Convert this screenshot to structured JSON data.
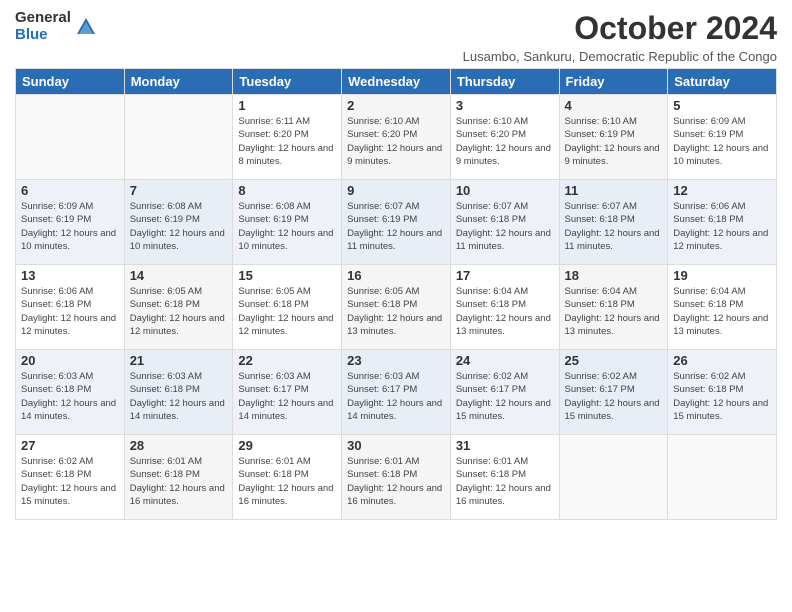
{
  "logo": {
    "general": "General",
    "blue": "Blue"
  },
  "title": "October 2024",
  "subtitle": "Lusambo, Sankuru, Democratic Republic of the Congo",
  "days_of_week": [
    "Sunday",
    "Monday",
    "Tuesday",
    "Wednesday",
    "Thursday",
    "Friday",
    "Saturday"
  ],
  "weeks": [
    [
      {
        "day": "",
        "info": ""
      },
      {
        "day": "",
        "info": ""
      },
      {
        "day": "1",
        "info": "Sunrise: 6:11 AM\nSunset: 6:20 PM\nDaylight: 12 hours and 8 minutes."
      },
      {
        "day": "2",
        "info": "Sunrise: 6:10 AM\nSunset: 6:20 PM\nDaylight: 12 hours and 9 minutes."
      },
      {
        "day": "3",
        "info": "Sunrise: 6:10 AM\nSunset: 6:20 PM\nDaylight: 12 hours and 9 minutes."
      },
      {
        "day": "4",
        "info": "Sunrise: 6:10 AM\nSunset: 6:19 PM\nDaylight: 12 hours and 9 minutes."
      },
      {
        "day": "5",
        "info": "Sunrise: 6:09 AM\nSunset: 6:19 PM\nDaylight: 12 hours and 10 minutes."
      }
    ],
    [
      {
        "day": "6",
        "info": "Sunrise: 6:09 AM\nSunset: 6:19 PM\nDaylight: 12 hours and 10 minutes."
      },
      {
        "day": "7",
        "info": "Sunrise: 6:08 AM\nSunset: 6:19 PM\nDaylight: 12 hours and 10 minutes."
      },
      {
        "day": "8",
        "info": "Sunrise: 6:08 AM\nSunset: 6:19 PM\nDaylight: 12 hours and 10 minutes."
      },
      {
        "day": "9",
        "info": "Sunrise: 6:07 AM\nSunset: 6:19 PM\nDaylight: 12 hours and 11 minutes."
      },
      {
        "day": "10",
        "info": "Sunrise: 6:07 AM\nSunset: 6:18 PM\nDaylight: 12 hours and 11 minutes."
      },
      {
        "day": "11",
        "info": "Sunrise: 6:07 AM\nSunset: 6:18 PM\nDaylight: 12 hours and 11 minutes."
      },
      {
        "day": "12",
        "info": "Sunrise: 6:06 AM\nSunset: 6:18 PM\nDaylight: 12 hours and 12 minutes."
      }
    ],
    [
      {
        "day": "13",
        "info": "Sunrise: 6:06 AM\nSunset: 6:18 PM\nDaylight: 12 hours and 12 minutes."
      },
      {
        "day": "14",
        "info": "Sunrise: 6:05 AM\nSunset: 6:18 PM\nDaylight: 12 hours and 12 minutes."
      },
      {
        "day": "15",
        "info": "Sunrise: 6:05 AM\nSunset: 6:18 PM\nDaylight: 12 hours and 12 minutes."
      },
      {
        "day": "16",
        "info": "Sunrise: 6:05 AM\nSunset: 6:18 PM\nDaylight: 12 hours and 13 minutes."
      },
      {
        "day": "17",
        "info": "Sunrise: 6:04 AM\nSunset: 6:18 PM\nDaylight: 12 hours and 13 minutes."
      },
      {
        "day": "18",
        "info": "Sunrise: 6:04 AM\nSunset: 6:18 PM\nDaylight: 12 hours and 13 minutes."
      },
      {
        "day": "19",
        "info": "Sunrise: 6:04 AM\nSunset: 6:18 PM\nDaylight: 12 hours and 13 minutes."
      }
    ],
    [
      {
        "day": "20",
        "info": "Sunrise: 6:03 AM\nSunset: 6:18 PM\nDaylight: 12 hours and 14 minutes."
      },
      {
        "day": "21",
        "info": "Sunrise: 6:03 AM\nSunset: 6:18 PM\nDaylight: 12 hours and 14 minutes."
      },
      {
        "day": "22",
        "info": "Sunrise: 6:03 AM\nSunset: 6:17 PM\nDaylight: 12 hours and 14 minutes."
      },
      {
        "day": "23",
        "info": "Sunrise: 6:03 AM\nSunset: 6:17 PM\nDaylight: 12 hours and 14 minutes."
      },
      {
        "day": "24",
        "info": "Sunrise: 6:02 AM\nSunset: 6:17 PM\nDaylight: 12 hours and 15 minutes."
      },
      {
        "day": "25",
        "info": "Sunrise: 6:02 AM\nSunset: 6:17 PM\nDaylight: 12 hours and 15 minutes."
      },
      {
        "day": "26",
        "info": "Sunrise: 6:02 AM\nSunset: 6:18 PM\nDaylight: 12 hours and 15 minutes."
      }
    ],
    [
      {
        "day": "27",
        "info": "Sunrise: 6:02 AM\nSunset: 6:18 PM\nDaylight: 12 hours and 15 minutes."
      },
      {
        "day": "28",
        "info": "Sunrise: 6:01 AM\nSunset: 6:18 PM\nDaylight: 12 hours and 16 minutes."
      },
      {
        "day": "29",
        "info": "Sunrise: 6:01 AM\nSunset: 6:18 PM\nDaylight: 12 hours and 16 minutes."
      },
      {
        "day": "30",
        "info": "Sunrise: 6:01 AM\nSunset: 6:18 PM\nDaylight: 12 hours and 16 minutes."
      },
      {
        "day": "31",
        "info": "Sunrise: 6:01 AM\nSunset: 6:18 PM\nDaylight: 12 hours and 16 minutes."
      },
      {
        "day": "",
        "info": ""
      },
      {
        "day": "",
        "info": ""
      }
    ]
  ]
}
